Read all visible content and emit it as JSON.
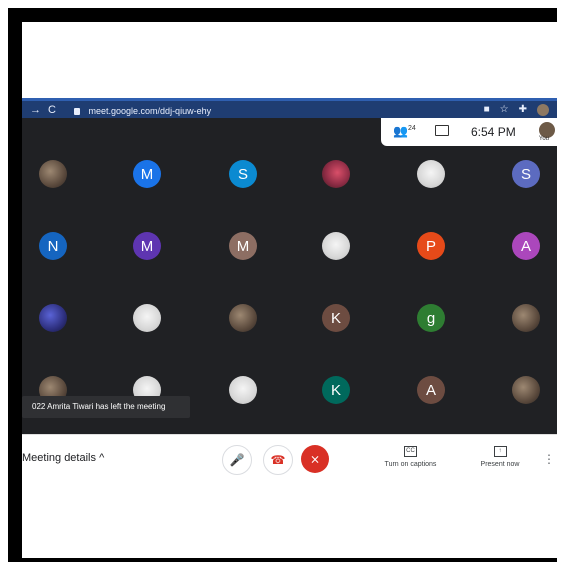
{
  "browser": {
    "nav_back": "→",
    "nav_reload": "C",
    "url": "meet.google.com/ddj-qiuw-ehy"
  },
  "meet": {
    "participants_count": "24",
    "time": "6:54 PM",
    "you_label": "You"
  },
  "participants": [
    {
      "label": "",
      "type": "photo"
    },
    {
      "label": "M",
      "color": "#1a73e8"
    },
    {
      "label": "S",
      "color": "#0b8ad1"
    },
    {
      "label": "",
      "type": "photo-red"
    },
    {
      "label": "",
      "type": "photo-light"
    },
    {
      "label": "S",
      "color": "#5c6bc0"
    },
    {
      "label": "N",
      "color": "#1565c0"
    },
    {
      "label": "M",
      "color": "#5e35b1"
    },
    {
      "label": "M",
      "color": "#8d6e63"
    },
    {
      "label": "",
      "type": "photo-light"
    },
    {
      "label": "P",
      "color": "#e64a19"
    },
    {
      "label": "A",
      "color": "#ab47bc"
    },
    {
      "label": "",
      "type": "photo-purple"
    },
    {
      "label": "",
      "type": "photo-light"
    },
    {
      "label": "",
      "type": "photo"
    },
    {
      "label": "K",
      "color": "#6d4c41"
    },
    {
      "label": "g",
      "color": "#2e7d32"
    },
    {
      "label": "",
      "type": "photo"
    },
    {
      "label": "",
      "type": "photo"
    },
    {
      "label": "",
      "type": "photo-light"
    },
    {
      "label": "",
      "type": "photo-light"
    },
    {
      "label": "K",
      "color": "#00695c"
    },
    {
      "label": "A",
      "color": "#6d4c41"
    },
    {
      "label": "",
      "type": "photo"
    }
  ],
  "toast": "022 Amrita Tiwari has left the meeting",
  "controls": {
    "meeting_details": "Meeting details",
    "captions": "Turn on captions",
    "present": "Present now"
  }
}
